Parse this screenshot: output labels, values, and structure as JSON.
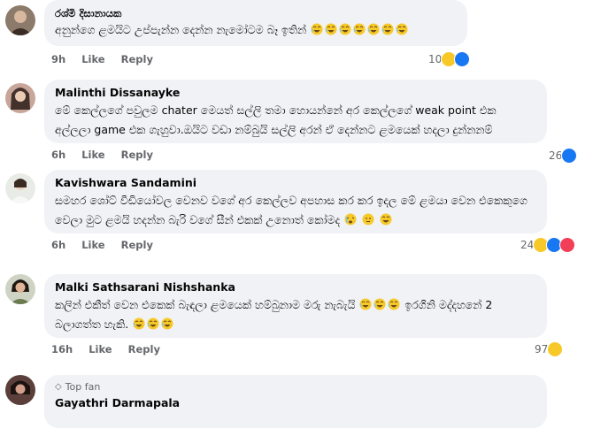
{
  "comments": [
    {
      "name": "රශ්මි දිසානායක",
      "text_lines": [
        "අනුන්ගෙ ළමයිට උප්පැන්න දෙන්න නැමෝටම බෑ ඉතින්"
      ],
      "emoji_count": 7,
      "time": "9h",
      "like": "Like",
      "reply": "Reply",
      "reaction_count": "10",
      "reaction_icons": [
        "haha",
        "like"
      ]
    },
    {
      "name": "Malinthi Dissanayke",
      "text_lines": [
        "මේ කෙල්ලගේ පවුලම chater මෙයත් සල්ලි තමා හොයන්නේ අර කෙල්ලගේ weak point එක",
        "අල්ලලා game එක ගැහුවා.ඔයිට වඩා නම්බුයි සල්ලි අරන් ඒ දෙන්නට ළමයෙක් හදලා දුන්නනම්"
      ],
      "time": "6h",
      "like": "Like",
      "reply": "Reply",
      "reaction_count": "26",
      "reaction_icons": [
        "like"
      ]
    },
    {
      "name": "Kavishwara Sandamini",
      "text_lines": [
        "සමහර ශෝට් වීඩියෝවල වෙනව වගේ අර කෙල්ලව අපහාස කර කර ඉදල මේ ළමයා වෙන එකෙකුගෙ",
        "වෙලා මුට ළමයි හදන්න බැරි වගේ සීන් එකක් උනොත් කෝමද"
      ],
      "time": "6h",
      "like": "Like",
      "reply": "Reply",
      "reaction_count": "24",
      "reaction_icons": [
        "haha",
        "like",
        "love"
      ]
    },
    {
      "name": "Malki Sathsarani Nishshanka",
      "text_lines": [
        "කලින් එකීත් වෙන එකෙක් බැඳලා ළමයෙක් හම්බුනාම මරු නැබැයි",
        "ඉරගිනි මද්දහනේ 2",
        "බලාගත්ත හැකි."
      ],
      "time": "16h",
      "like": "Like",
      "reply": "Reply",
      "reaction_count": "97",
      "reaction_icons": [
        "haha"
      ]
    },
    {
      "badge": "Top fan",
      "name": "Gayathri Darmapala"
    }
  ],
  "colors": {
    "bubble": "#f0f2f5",
    "meta": "#65676b",
    "like_blue": "#1877f2",
    "haha_yellow": "#f7c928",
    "love_red": "#f33e58"
  }
}
